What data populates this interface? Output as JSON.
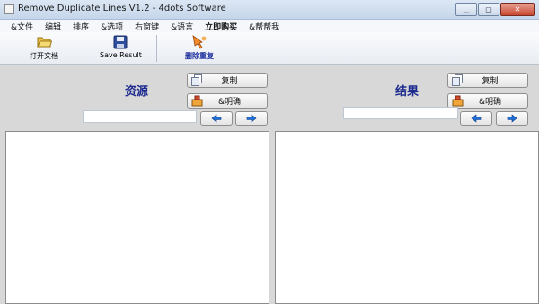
{
  "window": {
    "title": "Remove Duplicate Lines V1.2 - 4dots Software",
    "buttons": {
      "minimize": "▁",
      "maximize": "▢",
      "close": "✕"
    }
  },
  "menu": {
    "items": [
      "&文件",
      "编辑",
      "排序",
      "&选项",
      "右窗键",
      "&语言",
      "立即购买",
      "&帮帮我"
    ]
  },
  "toolbar": {
    "open": "打开文档",
    "save": "Save Result",
    "remove": "删除重复"
  },
  "left_panel": {
    "title": "资源",
    "copy": "复制",
    "clear": "&明确",
    "search_value": ""
  },
  "right_panel": {
    "title": "结果",
    "copy": "复制",
    "clear": "&明确",
    "search_value": ""
  },
  "colors": {
    "title_blue": "#1d2b8f",
    "arrow_blue": "#1f6ed6"
  }
}
